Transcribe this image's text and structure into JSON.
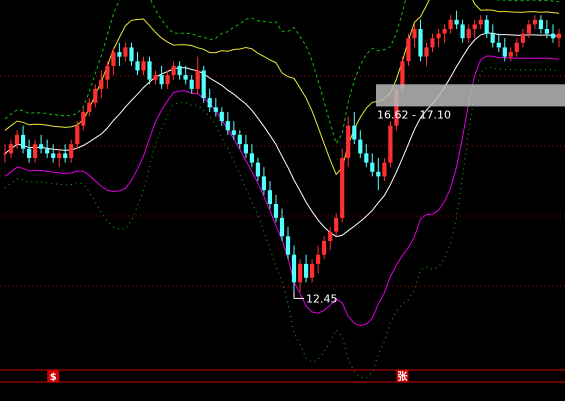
{
  "chart_data": {
    "type": "candlestick",
    "title": "",
    "xlabel": "",
    "ylabel": "",
    "grid": true,
    "ylim": [
      11.2,
      18.8
    ],
    "colors": {
      "background": "#000000",
      "up": "#ff3030",
      "down": "#54ffff",
      "grid": "#b00000",
      "mid_band": "#ffffff",
      "upper_band": "#e8e838",
      "lower_band": "#e000e0",
      "outer_upper": "#10c010",
      "outer_lower": "#10c010",
      "range_box": "#b8b8b8",
      "event_marker": "#d00000"
    },
    "range_annotation": {
      "text": "16.62 - 17.10",
      "low": 16.62,
      "high": 17.1
    },
    "low_annotation": {
      "text": "12.45",
      "value": 12.45
    },
    "event_markers": [
      {
        "text": "$",
        "index": 8
      },
      {
        "text": "张",
        "index": 66
      }
    ],
    "candles": [
      [
        15.6,
        15.8,
        15.4,
        15.6
      ],
      [
        15.6,
        15.9,
        15.5,
        15.8
      ],
      [
        15.8,
        16.1,
        15.7,
        16.0
      ],
      [
        16.0,
        16.2,
        15.6,
        15.7
      ],
      [
        15.7,
        15.9,
        15.4,
        15.5
      ],
      [
        15.5,
        15.9,
        15.4,
        15.8
      ],
      [
        15.8,
        16.0,
        15.6,
        15.7
      ],
      [
        15.7,
        15.9,
        15.5,
        15.6
      ],
      [
        15.6,
        15.8,
        15.4,
        15.5
      ],
      [
        15.5,
        15.7,
        15.3,
        15.6
      ],
      [
        15.6,
        15.8,
        15.4,
        15.5
      ],
      [
        15.5,
        15.9,
        15.4,
        15.8
      ],
      [
        15.8,
        16.3,
        15.7,
        16.2
      ],
      [
        16.2,
        16.6,
        16.1,
        16.5
      ],
      [
        16.5,
        16.8,
        16.4,
        16.7
      ],
      [
        16.7,
        17.1,
        16.6,
        17.0
      ],
      [
        17.0,
        17.4,
        16.8,
        17.2
      ],
      [
        17.2,
        17.6,
        17.0,
        17.5
      ],
      [
        17.5,
        17.9,
        17.3,
        17.8
      ],
      [
        17.8,
        18.0,
        17.5,
        17.7
      ],
      [
        17.7,
        18.0,
        17.6,
        17.9
      ],
      [
        17.9,
        18.0,
        17.5,
        17.6
      ],
      [
        17.6,
        17.8,
        17.3,
        17.4
      ],
      [
        17.4,
        17.7,
        17.3,
        17.6
      ],
      [
        17.6,
        17.7,
        17.1,
        17.2
      ],
      [
        17.2,
        17.4,
        17.1,
        17.3
      ],
      [
        17.3,
        17.5,
        17.0,
        17.1
      ],
      [
        17.1,
        17.4,
        17.0,
        17.3
      ],
      [
        17.3,
        17.6,
        17.2,
        17.5
      ],
      [
        17.5,
        17.6,
        17.2,
        17.3
      ],
      [
        17.3,
        17.5,
        17.1,
        17.2
      ],
      [
        17.2,
        17.3,
        16.9,
        17.0
      ],
      [
        17.0,
        17.7,
        16.9,
        17.4
      ],
      [
        17.4,
        17.5,
        16.7,
        16.8
      ],
      [
        16.8,
        17.0,
        16.5,
        16.6
      ],
      [
        16.6,
        16.8,
        16.4,
        16.5
      ],
      [
        16.5,
        16.6,
        16.2,
        16.3
      ],
      [
        16.3,
        16.5,
        16.0,
        16.1
      ],
      [
        16.1,
        16.3,
        15.9,
        16.0
      ],
      [
        16.0,
        16.1,
        15.7,
        15.8
      ],
      [
        15.8,
        16.0,
        15.5,
        15.6
      ],
      [
        15.6,
        15.8,
        15.3,
        15.4
      ],
      [
        15.4,
        15.5,
        15.0,
        15.1
      ],
      [
        15.1,
        15.3,
        14.7,
        14.8
      ],
      [
        14.8,
        15.0,
        14.4,
        14.5
      ],
      [
        14.5,
        14.7,
        14.1,
        14.2
      ],
      [
        14.2,
        14.4,
        13.7,
        13.8
      ],
      [
        13.8,
        14.0,
        13.3,
        13.4
      ],
      [
        13.4,
        13.6,
        12.6,
        12.8
      ],
      [
        12.8,
        13.3,
        12.6,
        13.2
      ],
      [
        13.2,
        13.4,
        12.8,
        12.9
      ],
      [
        12.9,
        13.3,
        12.8,
        13.2
      ],
      [
        13.2,
        13.6,
        13.0,
        13.4
      ],
      [
        13.4,
        13.8,
        13.3,
        13.7
      ],
      [
        13.7,
        14.0,
        13.5,
        13.9
      ],
      [
        13.9,
        14.3,
        13.8,
        14.2
      ],
      [
        14.2,
        15.7,
        14.1,
        15.5
      ],
      [
        15.5,
        16.4,
        15.3,
        16.2
      ],
      [
        16.2,
        16.5,
        15.8,
        15.9
      ],
      [
        15.9,
        16.1,
        15.5,
        15.6
      ],
      [
        15.6,
        15.8,
        15.3,
        15.4
      ],
      [
        15.4,
        15.6,
        15.1,
        15.2
      ],
      [
        15.2,
        15.5,
        14.8,
        15.1
      ],
      [
        15.1,
        15.5,
        15.0,
        15.4
      ],
      [
        15.4,
        16.3,
        15.3,
        16.2
      ],
      [
        16.2,
        17.1,
        16.1,
        17.0
      ],
      [
        17.0,
        17.7,
        16.9,
        17.6
      ],
      [
        17.6,
        18.2,
        17.5,
        18.1
      ],
      [
        18.1,
        18.4,
        17.9,
        18.3
      ],
      [
        18.3,
        18.5,
        17.6,
        17.7
      ],
      [
        17.7,
        18.0,
        17.5,
        17.9
      ],
      [
        17.9,
        18.2,
        17.8,
        18.1
      ],
      [
        18.1,
        18.3,
        17.9,
        18.2
      ],
      [
        18.2,
        18.4,
        18.0,
        18.3
      ],
      [
        18.3,
        18.6,
        18.2,
        18.5
      ],
      [
        18.5,
        18.7,
        18.3,
        18.4
      ],
      [
        18.4,
        18.5,
        18.0,
        18.1
      ],
      [
        18.1,
        18.4,
        18.0,
        18.3
      ],
      [
        18.3,
        18.5,
        18.1,
        18.4
      ],
      [
        18.4,
        18.6,
        18.3,
        18.5
      ],
      [
        18.5,
        18.6,
        18.1,
        18.2
      ],
      [
        18.2,
        18.4,
        17.9,
        18.0
      ],
      [
        18.0,
        18.2,
        17.8,
        17.9
      ],
      [
        17.9,
        18.1,
        17.6,
        17.7
      ],
      [
        17.7,
        17.9,
        17.6,
        17.8
      ],
      [
        17.8,
        18.1,
        17.7,
        18.0
      ],
      [
        18.0,
        18.3,
        17.9,
        18.2
      ],
      [
        18.2,
        18.5,
        18.1,
        18.4
      ],
      [
        18.4,
        18.6,
        18.3,
        18.5
      ],
      [
        18.5,
        18.6,
        18.2,
        18.3
      ],
      [
        18.3,
        18.5,
        18.1,
        18.2
      ],
      [
        18.2,
        18.4,
        18.0,
        18.1
      ],
      [
        18.1,
        18.3,
        17.9,
        18.2
      ]
    ]
  }
}
